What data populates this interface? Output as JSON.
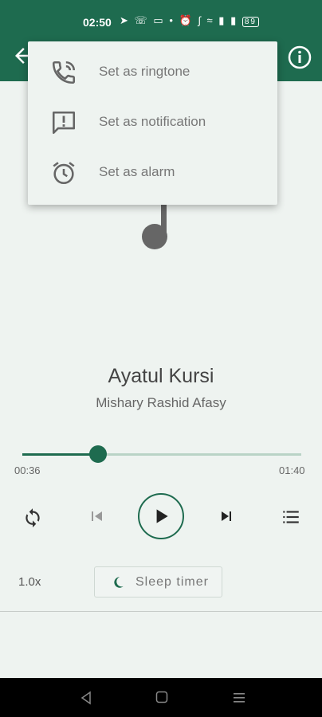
{
  "status_bar": {
    "time": "02:50",
    "battery": "89",
    "icons": [
      "telegram-icon",
      "whatsapp-icon",
      "message-icon",
      "dot-icon",
      "alarm-icon",
      "bluetooth-icon",
      "wifi-icon",
      "signal-icon",
      "signal-icon",
      "battery-icon"
    ]
  },
  "colors": {
    "primary": "#1e6b4f",
    "background": "#eef3f0",
    "track": "#b9d3c6"
  },
  "app_bar": {
    "back_icon": "back-arrow-icon",
    "info_icon": "info-icon"
  },
  "menu": {
    "items": [
      {
        "icon": "phone-ringtone-icon",
        "label": "Set as ringtone"
      },
      {
        "icon": "notification-icon",
        "label": "Set as notification"
      },
      {
        "icon": "alarm-clock-icon",
        "label": "Set as alarm"
      }
    ]
  },
  "player": {
    "title": "Ayatul Kursi",
    "artist": "Mishary Rashid Afasy",
    "current_time": "00:36",
    "total_time": "01:40",
    "progress": 0.27,
    "speed": "1.0x",
    "sleep_label": "Sleep timer"
  }
}
